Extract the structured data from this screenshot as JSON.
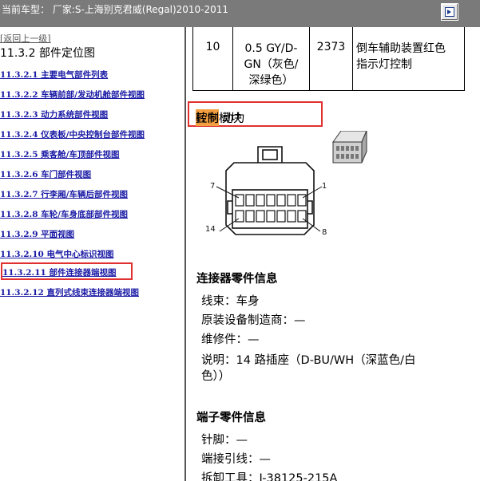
{
  "window": {
    "title": "当前车型： 厂家:S-上海别克君威(Regal)2010-2011",
    "button_icon": "play-icon"
  },
  "sidebar": {
    "back_link": "[返回上一级]",
    "heading": "11.3.2 部件定位图",
    "items": [
      {
        "label": "11.3.2.1 主要电气部件列表"
      },
      {
        "label": "11.3.2.2 车辆前部/发动机舱部件视图"
      },
      {
        "label": "11.3.2.3 动力系统部件视图"
      },
      {
        "label": "11.3.2.4 仪表板/中央控制台部件视图"
      },
      {
        "label": "11.3.2.5 乘客舱/车顶部件视图"
      },
      {
        "label": "11.3.2.6 车门部件视图"
      },
      {
        "label": "11.3.2.7 行李厢/车辆后部件视图"
      },
      {
        "label": "11.3.2.8 车轮/车身底部部件视图"
      },
      {
        "label": "11.3.2.9 平面视图"
      },
      {
        "label": "11.3.2.10 电气中心标识视图"
      },
      {
        "label": "11.3.2.11 部件连接器端视图"
      },
      {
        "label": "11.3.2.12 直列式线束连接器端视图"
      }
    ],
    "highlight_color": "#e03030"
  },
  "content": {
    "table_row": {
      "pin": "10",
      "wire_line1": "0.5 GY/D-",
      "wire_line2": "GN（灰色/",
      "wire_line3": "深绿色）",
      "circuit": "2373",
      "function_line1": "倒车辅助装置红色",
      "function_line2": "指示灯控制"
    },
    "module": {
      "prefix": "K43 动力",
      "highlight": "转向",
      "suffix": "控制模块",
      "highlight_color": "#f5a040"
    },
    "diagram": {
      "labels": [
        "7",
        "1",
        "14",
        "8"
      ]
    },
    "connector_info": {
      "title": "连接器零件信息",
      "harness": "线束：车身",
      "oem": "原装设备制造商：—",
      "service": "维修件：—",
      "desc1": "说明：14 路插座（D-BU/WH（深蓝色/白",
      "desc2": "色））"
    },
    "terminal_info": {
      "title": "端子零件信息",
      "pin": "针脚：—",
      "lead": "端接引线：—",
      "tool": "拆卸工具：J-38125-215A"
    }
  }
}
